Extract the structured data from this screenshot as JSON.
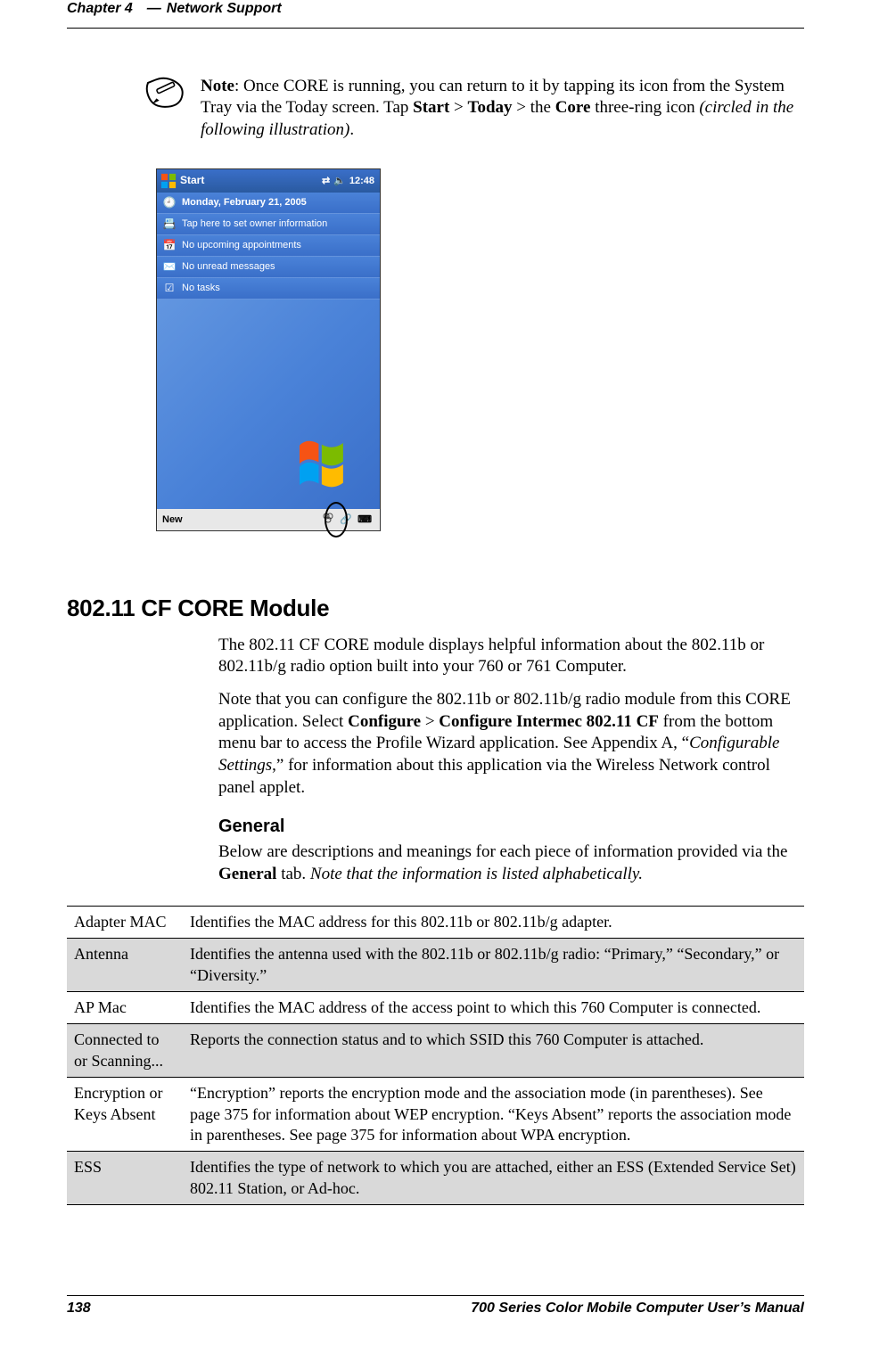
{
  "header": {
    "chapter": "Chapter 4",
    "dash": "—",
    "title": "Network Support"
  },
  "note": {
    "prefix": "Note",
    "text_1": ": Once CORE is running, you can return to it by tapping its icon from the System Tray via the Today screen. Tap ",
    "start": "Start",
    "gt1": " > ",
    "today": "Today",
    "gt2": " > the ",
    "core": "Core",
    "text_2": " three-ring icon ",
    "paren": "(circled in the following illustration)",
    "text_3": "."
  },
  "pda": {
    "start_label": "Start",
    "clock": "12:48",
    "date": "Monday, February 21, 2005",
    "owner": "Tap here to set owner information",
    "appointments": "No upcoming appointments",
    "messages": "No unread messages",
    "tasks": "No tasks",
    "new_label": "New"
  },
  "section": {
    "title": "802.11 CF CORE Module",
    "para1": "The 802.11 CF CORE module displays helpful information about the 802.11b or 802.11b/g radio option built into your 760 or 761 Computer.",
    "para2_a": "Note that you can configure the 802.11b or 802.11b/g radio module from this CORE application. Select ",
    "para2_b": "Configure",
    "para2_c": " > ",
    "para2_d": "Configure Intermec 802.11 CF",
    "para2_e": " from the bottom menu bar to access the Profile Wizard application. See Appendix A, “",
    "para2_f": "Configurable Settings",
    "para2_g": ",” for information about this application via the Wireless Network control panel applet.",
    "general_heading": "General",
    "general_para_a": "Below are descriptions and meanings for each piece of information provided via the ",
    "general_para_b": "General",
    "general_para_c": " tab. ",
    "general_para_d": "Note that the information is listed alphabetically."
  },
  "table": [
    {
      "term": "Adapter MAC",
      "desc": "Identifies the MAC address for this 802.11b or 802.11b/g adapter."
    },
    {
      "term": "Antenna",
      "desc": "Identifies the antenna used with the 802.11b or 802.11b/g radio: “Primary,” “Secondary,” or “Diversity.”"
    },
    {
      "term": "AP Mac",
      "desc": "Identifies the MAC address of the access point to which this 760 Computer is connected."
    },
    {
      "term": "Connected to or Scanning...",
      "desc": "Reports the connection status and to which SSID this 760 Computer is attached."
    },
    {
      "term": "Encryption or Keys Absent",
      "desc": "“Encryption” reports the encryption mode and the association mode (in parentheses). See page 375 for information about WEP encryption. “Keys Absent” reports the association mode in parentheses. See page 375 for information about WPA encryption."
    },
    {
      "term": "ESS",
      "desc": "Identifies the type of network to which you are attached, either an ESS (Extended Service Set) 802.11 Station, or Ad-hoc."
    }
  ],
  "footer": {
    "page": "138",
    "docname": "700 Series Color Mobile Computer User’s Manual"
  }
}
